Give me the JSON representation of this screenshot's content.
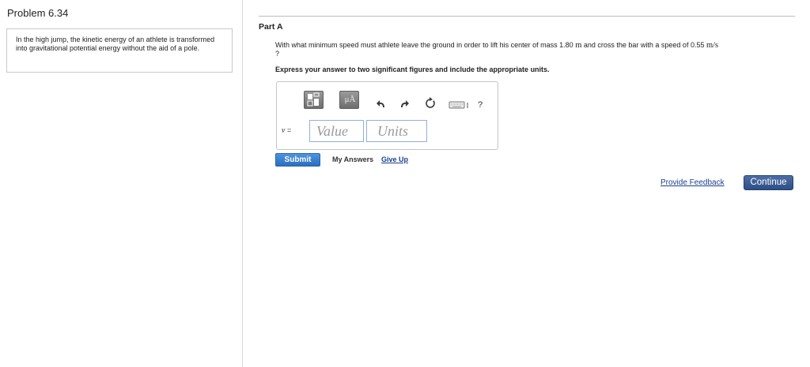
{
  "problem": {
    "title": "Problem 6.34",
    "text": "In the high jump, the kinetic energy of an athlete is transformed into gravitational potential energy without the aid of a pole."
  },
  "part": {
    "title": "Part A",
    "question_before_mass": "With what minimum speed must athlete leave the ground in order to lift his center of mass 1.80 ",
    "mass_unit": "m",
    "question_middle": " and cross the bar with a speed of 0.55 ",
    "speed_unit": "m/s",
    "question_end": "?",
    "instructions": "Express your answer to two significant figures and include the appropriate units."
  },
  "toolbar": {
    "symbols_label": "μÅ",
    "help_label": "?",
    "icons": [
      "templates-icon",
      "symbols-icon",
      "undo-icon",
      "redo-icon",
      "reset-icon",
      "keyboard-icon",
      "help-icon"
    ]
  },
  "answer": {
    "variable": "v",
    "equals": " =",
    "value_placeholder": "Value",
    "units_placeholder": "Units"
  },
  "actions": {
    "submit": "Submit",
    "my_answers": "My Answers",
    "give_up": "Give Up",
    "provide_feedback": "Provide Feedback",
    "continue": "Continue"
  },
  "colors": {
    "submit_bg": "#3b82d4",
    "continue_bg": "#3a5d95",
    "link": "#1a3f8f"
  }
}
